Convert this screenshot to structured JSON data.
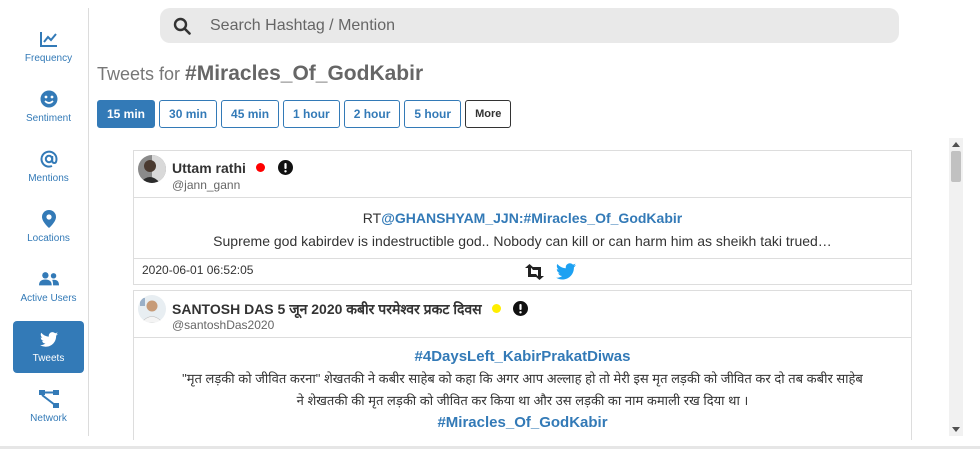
{
  "sidebar": {
    "items": [
      {
        "label": "Frequency",
        "icon": "chart-line-icon"
      },
      {
        "label": "Sentiment",
        "icon": "smile-icon"
      },
      {
        "label": "Mentions",
        "icon": "at-icon"
      },
      {
        "label": "Locations",
        "icon": "map-marker-icon"
      },
      {
        "label": "Active Users",
        "icon": "users-icon"
      },
      {
        "label": "Tweets",
        "icon": "twitter-icon",
        "active": true
      },
      {
        "label": "Network",
        "icon": "network-icon"
      }
    ]
  },
  "search": {
    "placeholder": "Search Hashtag / Mention",
    "value": ""
  },
  "heading": {
    "prefix": "Tweets for",
    "hashtag": "#Miracles_Of_GodKabir"
  },
  "time_buttons": {
    "options": [
      "15 min",
      "30 min",
      "45 min",
      "1 hour",
      "2 hour",
      "5 hour"
    ],
    "selected": "15 min",
    "more_label": "More"
  },
  "tweets": [
    {
      "user_name": "Uttam rathi",
      "handle": "@jann_gann",
      "status_color": "#ff0000",
      "rt_prefix": "RT",
      "rt_mention": "@GHANSHYAM_JJN:#Miracles_Of_GodKabir",
      "text": "Supreme god kabirdev is indestructible god.. Nobody can kill or can harm him as sheikh taki trued…",
      "timestamp": "2020-06-01 06:52:05"
    },
    {
      "user_name": "SANTOSH DAS 5 जून 2020 कबीर परमेश्वर प्रकट दिवस",
      "handle": "@santoshDas2020",
      "status_color": "#ffee00",
      "hashtag_top": "#4DaysLeft_KabirPrakatDiwas",
      "text_line1": "\"मृत लड़की को जीवित करना\" शेखतकी ने कबीर साहेब को कहा कि अगर आप अल्लाह हो तो मेरी इस मृत लड़की को जीवित कर दो तब कबीर साहेब",
      "text_line2": "ने शेखतकी की मृत लड़की को जीवित कर किया था और उस लड़की का नाम कमाली रख दिया था ।",
      "hashtag_bottom": "#Miracles_Of_GodKabir"
    }
  ],
  "colors": {
    "accent": "#337ab7"
  }
}
